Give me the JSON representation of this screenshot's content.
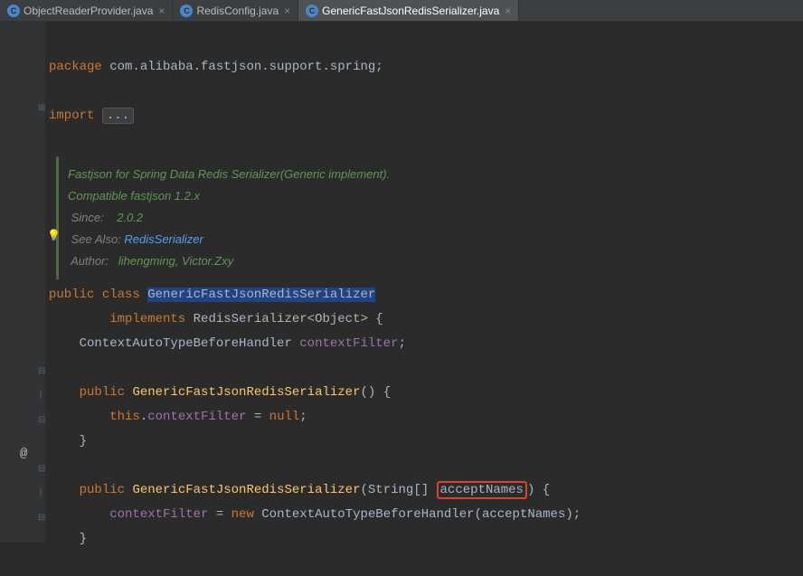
{
  "tabs": [
    {
      "name": "ObjectReaderProvider.java",
      "active": false
    },
    {
      "name": "RedisConfig.java",
      "active": false
    },
    {
      "name": "GenericFastJsonRedisSerializer.java",
      "active": true
    }
  ],
  "code": {
    "package_kw": "package",
    "package_name": "com.alibaba.fastjson.support.spring",
    "import_kw": "import",
    "import_ellipsis": "...",
    "doc": {
      "line1": "Fastjson for Spring Data Redis Serializer(Generic implement).",
      "line2": "Compatible fastjson 1.2.x",
      "since_label": "Since:",
      "since_val": "2.0.2",
      "see_label": "See Also:",
      "see_val": "RedisSerializer",
      "author_label": "Author:",
      "author_val": "lihengming, Victor.Zxy"
    },
    "public_kw": "public",
    "class_kw": "class",
    "class_name": "GenericFastJsonRedisSerializer",
    "implements_kw": "implements",
    "impl_type": "RedisSerializer",
    "impl_generic": "Object",
    "field_type": "ContextAutoTypeBeforeHandler",
    "field_name": "contextFilter",
    "ctor1_name": "GenericFastJsonRedisSerializer",
    "this_kw": "this",
    "null_kw": "null",
    "ctor2_name": "GenericFastJsonRedisSerializer",
    "param_type": "String",
    "param_name": "acceptNames",
    "new_kw": "new",
    "handler_type": "ContextAutoTypeBeforeHandler"
  }
}
